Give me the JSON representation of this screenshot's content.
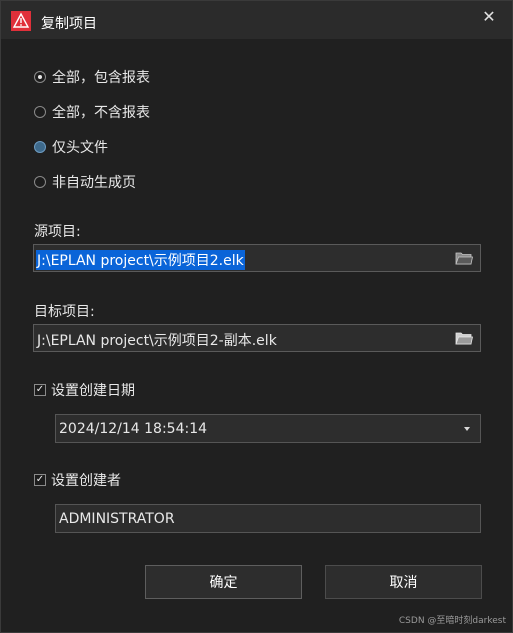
{
  "window": {
    "title": "复制项目",
    "close_glyph": "✕",
    "icon": "eplan-app-icon"
  },
  "options": [
    {
      "label": "全部，包含报表",
      "checked": true
    },
    {
      "label": "全部，不含报表",
      "checked": false
    },
    {
      "label": "仅头文件",
      "checked": false
    },
    {
      "label": "非自动生成页",
      "checked": false
    }
  ],
  "source": {
    "label": "源项目:",
    "value": "J:\\EPLAN project\\示例项目2.elk",
    "browse_icon": "folder-icon"
  },
  "target": {
    "label": "目标项目:",
    "value": "J:\\EPLAN project\\示例项目2-副本.elk",
    "browse_icon": "folder-icon"
  },
  "creation_date": {
    "label": "设置创建日期",
    "checked": true,
    "checkmark": "✓",
    "value": "2024/12/14 18:54:14"
  },
  "creator": {
    "label": "设置创建者",
    "checked": true,
    "checkmark": "✓",
    "value": "ADMINISTRATOR"
  },
  "buttons": {
    "ok": "确定",
    "cancel": "取消"
  },
  "watermark": "CSDN @至暗时刻darkest",
  "colors": {
    "background": "#202020",
    "titlebar": "#2b2b2b",
    "selection": "#0a64d8",
    "app_icon_red": "#e0303a"
  }
}
